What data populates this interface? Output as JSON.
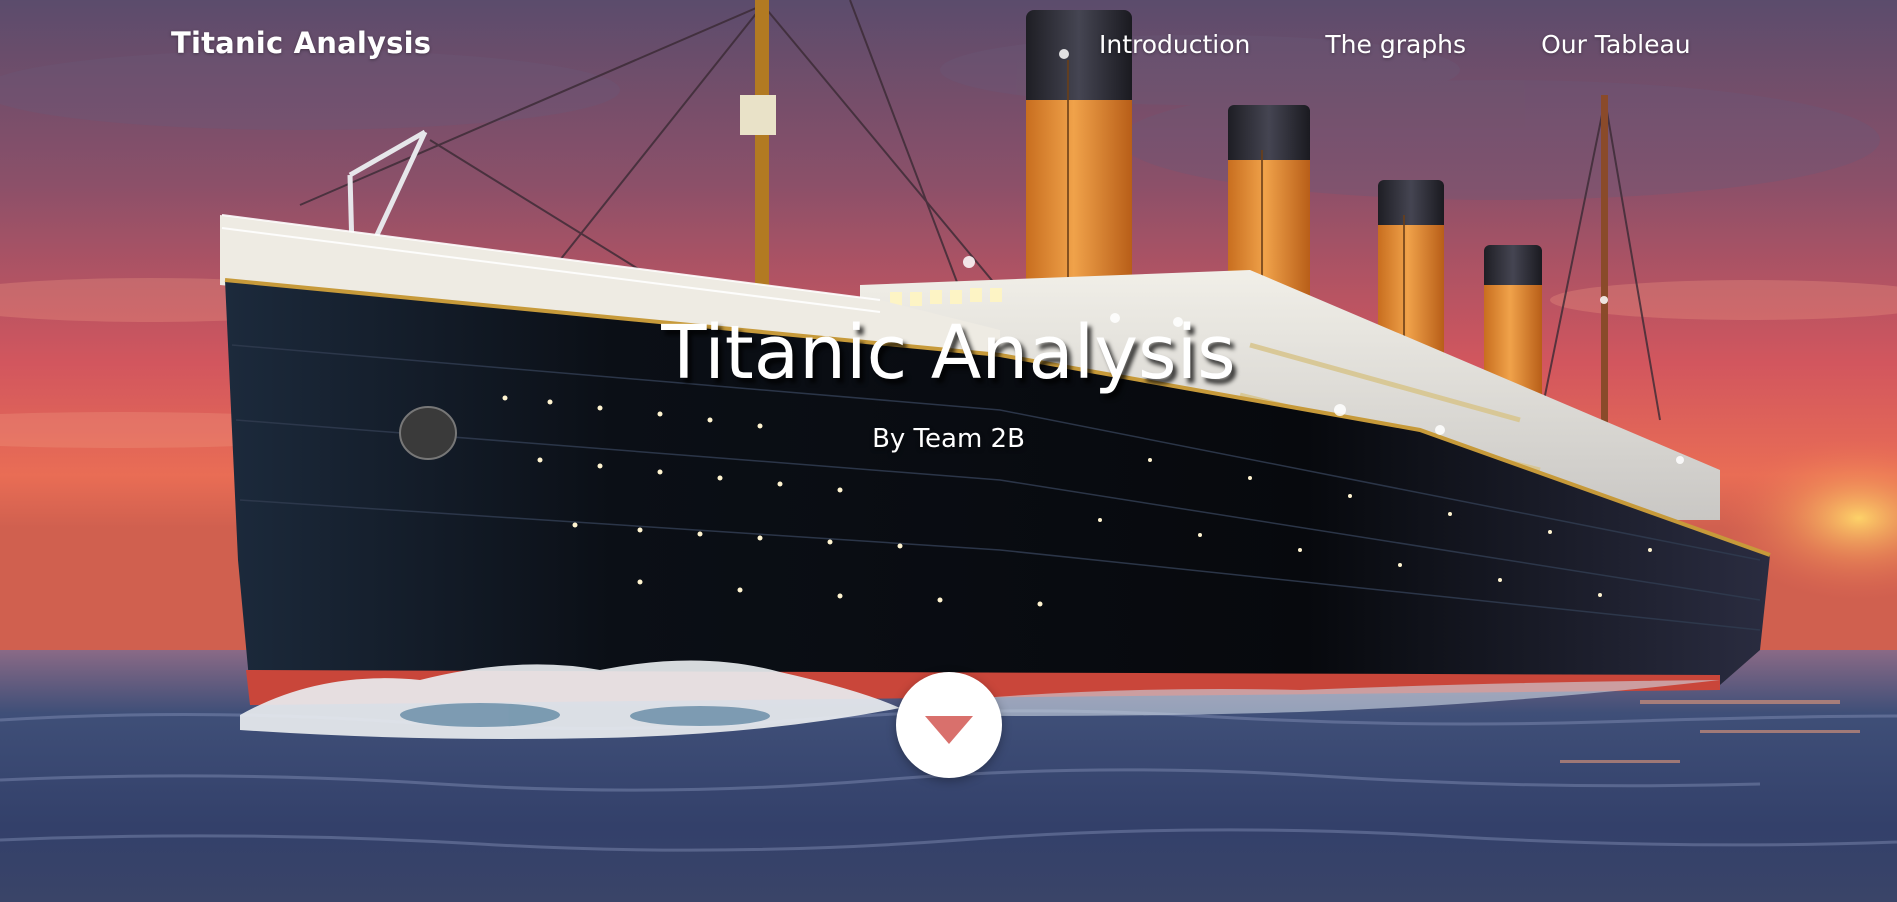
{
  "navbar": {
    "brand": "Titanic Analysis",
    "links": [
      {
        "label": "Introduction"
      },
      {
        "label": "The graphs"
      },
      {
        "label": "Our Tableau"
      }
    ]
  },
  "hero": {
    "title": "Titanic Analysis",
    "subtitle": "By Team 2B",
    "scroll_icon": "caret-down-icon"
  },
  "colors": {
    "accent": "#d9706c",
    "text": "#ffffff"
  }
}
